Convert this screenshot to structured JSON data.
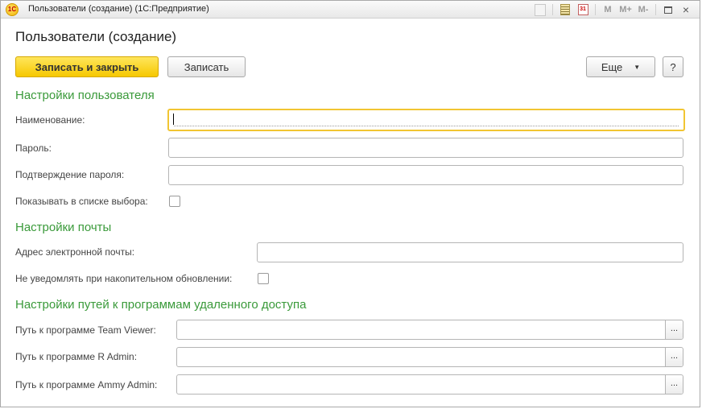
{
  "window": {
    "title": "Пользователи (создание)  (1С:Предприятие)",
    "logo_text": "1С",
    "calendar_text": "31",
    "mem_buttons": [
      "M",
      "M+",
      "M-"
    ],
    "close_glyph": "×"
  },
  "form": {
    "title": "Пользователи (создание)",
    "buttons": {
      "save_close": "Записать и закрыть",
      "save": "Записать",
      "more": "Еще",
      "more_arrow": "▼",
      "help": "?"
    },
    "sections": {
      "user_settings": {
        "title": "Настройки пользователя",
        "name_label": "Наименование:",
        "name_value": "",
        "password_label": "Пароль:",
        "password_value": "",
        "confirm_label": "Подтверждение пароля:",
        "confirm_value": "",
        "show_in_list_label": "Показывать в списке выбора:",
        "show_in_list_checked": false
      },
      "mail_settings": {
        "title": "Настройки почты",
        "email_label": "Адрес электронной почты:",
        "email_value": "",
        "no_notify_label": "Не уведомлять при накопительном обновлении:",
        "no_notify_checked": false
      },
      "remote_settings": {
        "title": "Настройки путей к программам удаленного доступа",
        "teamviewer_label": "Путь к программе Team Viewer:",
        "teamviewer_value": "",
        "radmin_label": "Путь к программе R Admin:",
        "radmin_value": "",
        "ammy_label": "Путь к программе Ammy Admin:",
        "ammy_value": "",
        "browse_glyph": "..."
      }
    }
  },
  "colors": {
    "accent_yellow": "#f6c800",
    "section_green": "#3a9a3a",
    "focus_border": "#f1c532"
  }
}
